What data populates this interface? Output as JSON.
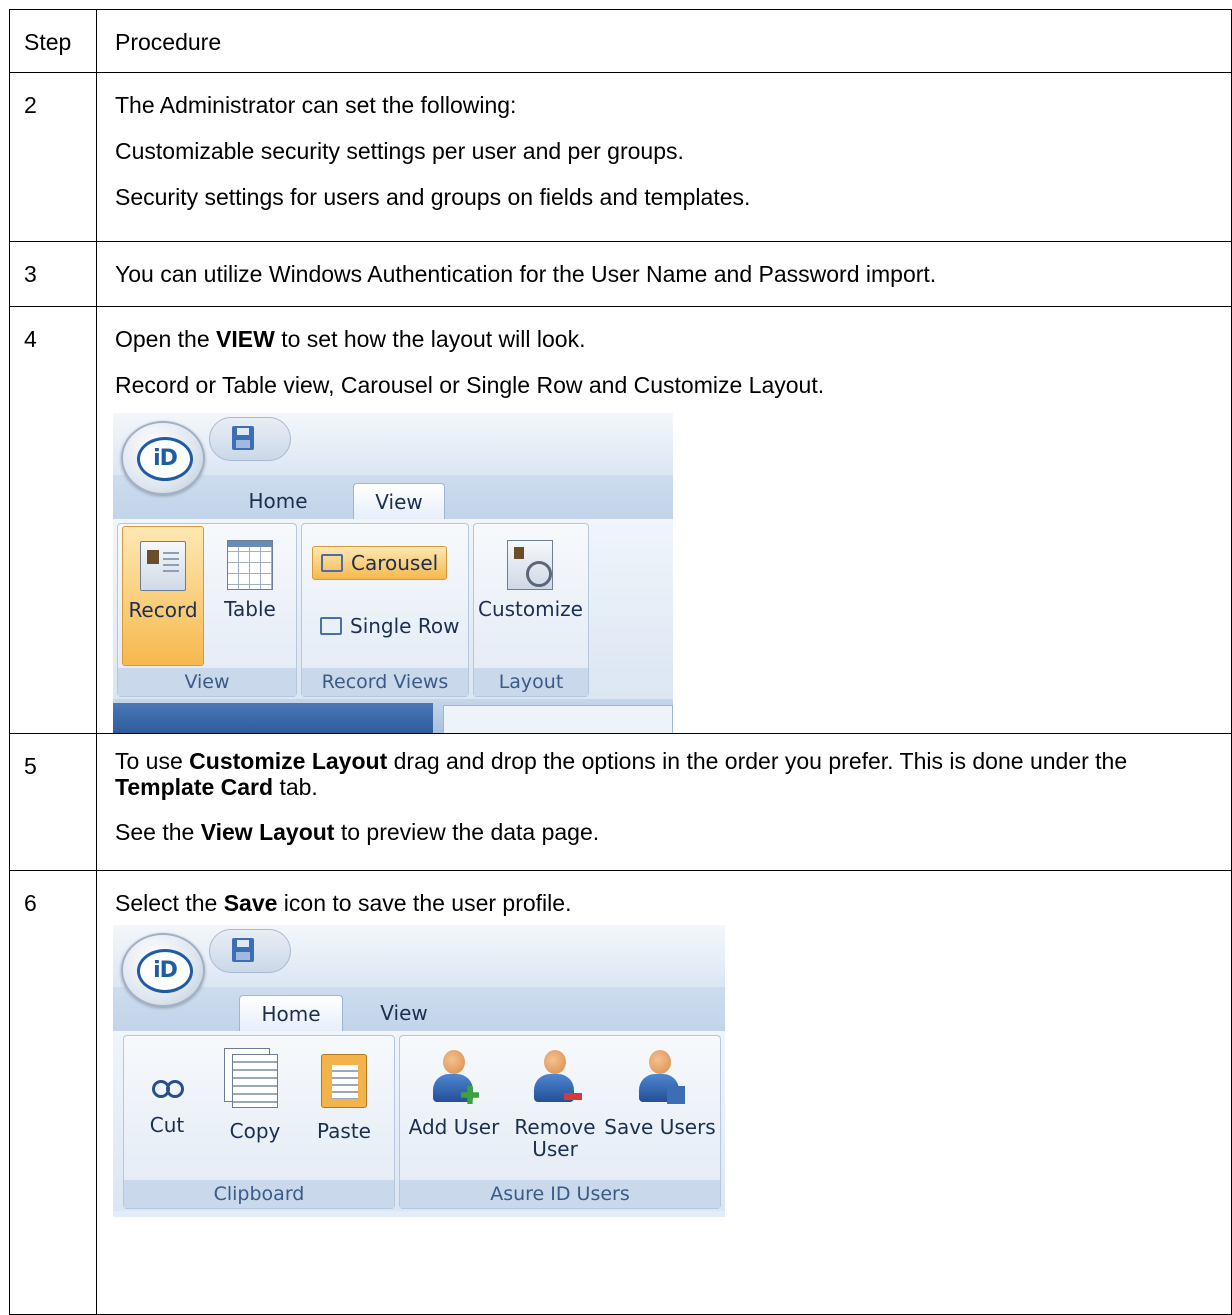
{
  "header": {
    "step": "Step",
    "procedure": "Procedure"
  },
  "rows": [
    {
      "step": "2",
      "lines": [
        "The Administrator can set the following:",
        "Customizable security settings per user and per groups.",
        "Security settings for users and groups on fields and templates."
      ]
    },
    {
      "step": "3",
      "lines": [
        "You can utilize Windows Authentication for the User Name and Password import."
      ]
    },
    {
      "step": "4",
      "line1": {
        "pre": "Open the ",
        "bold": "VIEW",
        "post": " to set how the layout will look."
      },
      "line2": "Record or Table view, Carousel or Single Row and Customize Layout."
    },
    {
      "step": "5",
      "line1": {
        "pre": "To use ",
        "bold1": "Customize Layout",
        "mid": " drag and drop the options in the order you prefer. This is done under the ",
        "bold2": "Template Card",
        "post": " tab."
      },
      "line2": {
        "pre": "See the ",
        "bold": "View Layout",
        "post": " to preview the data page."
      }
    },
    {
      "step": "6",
      "line1": {
        "pre": "Select the ",
        "bold": "Save",
        "post": " icon to save the user profile."
      }
    }
  ],
  "ribbon_view": {
    "logo": "iD",
    "tabs": [
      "Home",
      "View"
    ],
    "active_tab": "View",
    "buttons": {
      "record": "Record",
      "table": "Table",
      "carousel": "Carousel",
      "single_row": "Single Row",
      "customize": "Customize"
    },
    "groups": [
      "View",
      "Record Views",
      "Layout"
    ],
    "icons": [
      "record-icon",
      "table-icon",
      "carousel-icon",
      "single-row-icon",
      "customize-icon",
      "save-icon"
    ]
  },
  "ribbon_home": {
    "logo": "iD",
    "tabs": [
      "Home",
      "View"
    ],
    "active_tab": "Home",
    "buttons": {
      "cut": "Cut",
      "copy": "Copy",
      "paste": "Paste",
      "add_user": "Add User",
      "remove_user_1": "Remove",
      "remove_user_2": "User",
      "save_users": "Save Users"
    },
    "groups": [
      "Clipboard",
      "Asure ID Users"
    ],
    "icons": [
      "cut-icon",
      "copy-icon",
      "paste-icon",
      "add-user-icon",
      "remove-user-icon",
      "save-users-icon",
      "save-icon"
    ]
  }
}
